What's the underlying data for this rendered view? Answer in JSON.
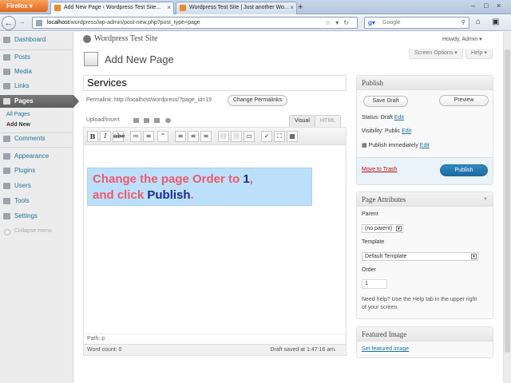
{
  "browser": {
    "firefox_label": "Firefox",
    "tabs": [
      {
        "label": "Add New Page ‹ Wordpress Test Site..."
      },
      {
        "label": "Wordpress Test Site | Just another Wo..."
      }
    ],
    "url_host": "localhost",
    "url_path": "/wordpress/wp-admin/post-new.php?post_type=page",
    "search_placeholder": "Google"
  },
  "admin": {
    "site_title": "Wordpress Test Site",
    "howdy": "Howdy, Admin",
    "screen_options": "Screen Options",
    "help": "Help",
    "page_heading": "Add New Page"
  },
  "sidebar": {
    "items": [
      {
        "label": "Dashboard"
      },
      {
        "label": "Posts"
      },
      {
        "label": "Media"
      },
      {
        "label": "Links"
      },
      {
        "label": "Pages"
      },
      {
        "label": "Comments"
      },
      {
        "label": "Appearance"
      },
      {
        "label": "Plugins"
      },
      {
        "label": "Users"
      },
      {
        "label": "Tools"
      },
      {
        "label": "Settings"
      }
    ],
    "sub_items": [
      {
        "label": "All Pages"
      },
      {
        "label": "Add New"
      }
    ],
    "collapse": "Collapse menu"
  },
  "editor": {
    "title_value": "Services",
    "permalink": "Permalink: http://localhost/wordpress/?page_id=19",
    "change_permalinks": "Change Permalinks",
    "upload_insert": "Upload/Insert",
    "tab_visual": "Visual",
    "tab_html": "HTML",
    "path": "Path: p",
    "word_count": "Word count: 0",
    "draft_saved": "Draft saved at 1:47:16 am."
  },
  "overlay": {
    "part1": "Change the page Order to ",
    "highlight1": "1",
    "part2": ",",
    "part3": "and click ",
    "highlight2": "Publish",
    "part4": "."
  },
  "publish": {
    "heading": "Publish",
    "save_draft": "Save Draft",
    "preview": "Preview",
    "status": "Status: Draft",
    "status_edit": "Edit",
    "visibility": "Visibility: Public",
    "visibility_edit": "Edit",
    "schedule": "Publish immediately",
    "schedule_edit": "Edit",
    "trash": "Move to Trash",
    "publish_button": "Publish"
  },
  "attributes": {
    "heading": "Page Attributes",
    "parent_label": "Parent",
    "parent_value": "(no parent)",
    "template_label": "Template",
    "template_value": "Default Template",
    "order_label": "Order",
    "order_value": "1",
    "help_text_1": "Need help? Use the Help tab in the upper right",
    "help_text_2": "of your screen."
  },
  "featured": {
    "heading": "Featured Image",
    "link": "Set featured image"
  }
}
